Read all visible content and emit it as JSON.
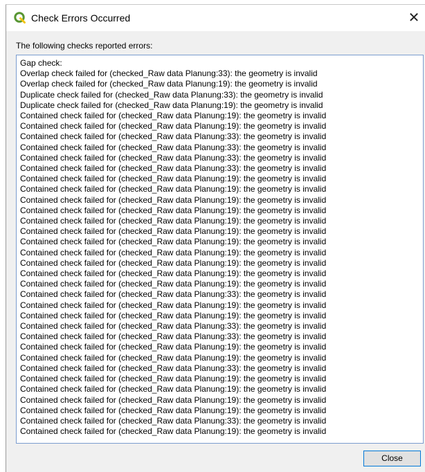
{
  "window": {
    "title": "Check Errors Occurred",
    "close_glyph": "✕"
  },
  "prompt": "The following checks reported errors:",
  "errors": [
    "Gap check:",
    "Overlap check failed for (checked_Raw data Planung:33): the geometry is invalid",
    "Overlap check failed for (checked_Raw data Planung:19): the geometry is invalid",
    "Duplicate check failed for (checked_Raw data Planung:33): the geometry is invalid",
    "Duplicate check failed for (checked_Raw data Planung:19): the geometry is invalid",
    "Contained check failed for (checked_Raw data Planung:19): the geometry is invalid",
    "Contained check failed for (checked_Raw data Planung:19): the geometry is invalid",
    "Contained check failed for (checked_Raw data Planung:33): the geometry is invalid",
    "Contained check failed for (checked_Raw data Planung:33): the geometry is invalid",
    "Contained check failed for (checked_Raw data Planung:33): the geometry is invalid",
    "Contained check failed for (checked_Raw data Planung:33): the geometry is invalid",
    "Contained check failed for (checked_Raw data Planung:19): the geometry is invalid",
    "Contained check failed for (checked_Raw data Planung:19): the geometry is invalid",
    "Contained check failed for (checked_Raw data Planung:19): the geometry is invalid",
    "Contained check failed for (checked_Raw data Planung:19): the geometry is invalid",
    "Contained check failed for (checked_Raw data Planung:19): the geometry is invalid",
    "Contained check failed for (checked_Raw data Planung:19): the geometry is invalid",
    "Contained check failed for (checked_Raw data Planung:19): the geometry is invalid",
    "Contained check failed for (checked_Raw data Planung:19): the geometry is invalid",
    "Contained check failed for (checked_Raw data Planung:19): the geometry is invalid",
    "Contained check failed for (checked_Raw data Planung:19): the geometry is invalid",
    "Contained check failed for (checked_Raw data Planung:19): the geometry is invalid",
    "Contained check failed for (checked_Raw data Planung:33): the geometry is invalid",
    "Contained check failed for (checked_Raw data Planung:19): the geometry is invalid",
    "Contained check failed for (checked_Raw data Planung:19): the geometry is invalid",
    "Contained check failed for (checked_Raw data Planung:33): the geometry is invalid",
    "Contained check failed for (checked_Raw data Planung:33): the geometry is invalid",
    "Contained check failed for (checked_Raw data Planung:19): the geometry is invalid",
    "Contained check failed for (checked_Raw data Planung:19): the geometry is invalid",
    "Contained check failed for (checked_Raw data Planung:33): the geometry is invalid",
    "Contained check failed for (checked_Raw data Planung:19): the geometry is invalid",
    "Contained check failed for (checked_Raw data Planung:19): the geometry is invalid",
    "Contained check failed for (checked_Raw data Planung:19): the geometry is invalid",
    "Contained check failed for (checked_Raw data Planung:19): the geometry is invalid",
    "Contained check failed for (checked_Raw data Planung:33): the geometry is invalid",
    "Contained check failed for (checked_Raw data Planung:19): the geometry is invalid"
  ],
  "buttons": {
    "close": "Close"
  },
  "colors": {
    "qgis_green": "#589632",
    "qgis_yellow": "#ee7913",
    "focus_border": "#0078d7"
  }
}
